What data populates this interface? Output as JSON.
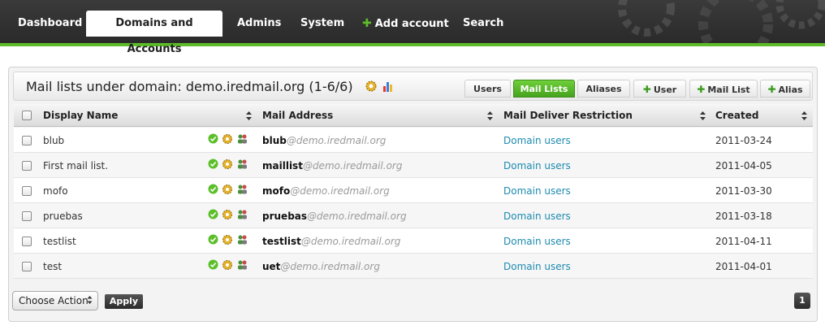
{
  "nav": {
    "items": [
      {
        "label": "Dashboard"
      },
      {
        "label": "Domains and Accounts"
      },
      {
        "label": "Admins"
      },
      {
        "label": "System"
      },
      {
        "label": "Add account"
      },
      {
        "label": "Search"
      }
    ]
  },
  "panel": {
    "title": "Mail lists under domain: demo.iredmail.org (1-6/6)",
    "tabs": [
      {
        "label": "Users"
      },
      {
        "label": "Mail Lists"
      },
      {
        "label": "Aliases"
      },
      {
        "label": "User"
      },
      {
        "label": "Mail List"
      },
      {
        "label": "Alias"
      }
    ]
  },
  "table": {
    "headers": {
      "display_name": "Display Name",
      "mail_address": "Mail Address",
      "restriction": "Mail Deliver Restriction",
      "created": "Created"
    },
    "rows": [
      {
        "display_name": "blub",
        "user": "blub",
        "domain": "@demo.iredmail.org",
        "restriction": "Domain users",
        "created": "2011-03-24"
      },
      {
        "display_name": "First mail list.",
        "user": "maillist",
        "domain": "@demo.iredmail.org",
        "restriction": "Domain users",
        "created": "2011-04-05"
      },
      {
        "display_name": "mofo",
        "user": "mofo",
        "domain": "@demo.iredmail.org",
        "restriction": "Domain users",
        "created": "2011-03-30"
      },
      {
        "display_name": "pruebas",
        "user": "pruebas",
        "domain": "@demo.iredmail.org",
        "restriction": "Domain users",
        "created": "2011-03-18"
      },
      {
        "display_name": "testlist",
        "user": "testlist",
        "domain": "@demo.iredmail.org",
        "restriction": "Domain users",
        "created": "2011-04-11"
      },
      {
        "display_name": "test",
        "user": "uet",
        "domain": "@demo.iredmail.org",
        "restriction": "Domain users",
        "created": "2011-04-01"
      }
    ]
  },
  "footer": {
    "select_value": "Choose Action",
    "apply_label": "Apply",
    "page": "1"
  },
  "colors": {
    "accent_green": "#5dbb2a",
    "link_blue": "#1d8bb0",
    "nav_bg": "#2f2f2f"
  }
}
